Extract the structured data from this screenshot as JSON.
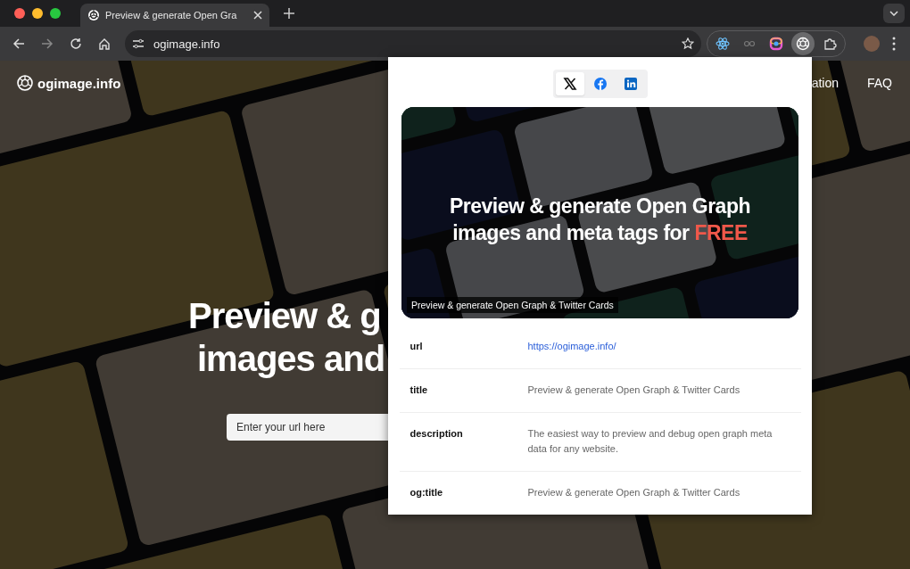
{
  "browser": {
    "tab": {
      "title": "Preview & generate Open Gra",
      "selected": true
    },
    "address": "ogimage.info",
    "bookmarked": false,
    "extensions": [
      {
        "kind": "atom",
        "selected": false
      },
      {
        "kind": "glasses",
        "selected": false
      },
      {
        "kind": "ring",
        "selected": false
      },
      {
        "kind": "aperture",
        "selected": true
      },
      {
        "kind": "puzzle",
        "selected": false
      }
    ]
  },
  "site": {
    "logo": "ogimage.info",
    "nav": [
      "ation",
      "FAQ"
    ],
    "hero_lines": [
      "Preview & g",
      "images and"
    ],
    "url_field": {
      "placeholder": "Enter your url here"
    }
  },
  "popup": {
    "share_tabs": [
      {
        "kind": "x",
        "selected": true
      },
      {
        "kind": "facebook",
        "selected": false
      },
      {
        "kind": "linkedin",
        "selected": false
      }
    ],
    "preview": {
      "title": "Preview & generate Open Graph images and meta tags for",
      "highlight": "FREE",
      "caption": "Preview & generate Open Graph & Twitter Cards"
    },
    "meta": [
      {
        "key": "url",
        "value": "https://ogimage.info/",
        "kind": "link"
      },
      {
        "key": "title",
        "value": "Preview & generate Open Graph & Twitter Cards",
        "kind": "text"
      },
      {
        "key": "description",
        "value": "The easiest way to preview and debug open graph meta data for any website.",
        "kind": "text"
      },
      {
        "key": "og:title",
        "value": "Preview & generate Open Graph & Twitter Cards",
        "kind": "text"
      }
    ]
  }
}
